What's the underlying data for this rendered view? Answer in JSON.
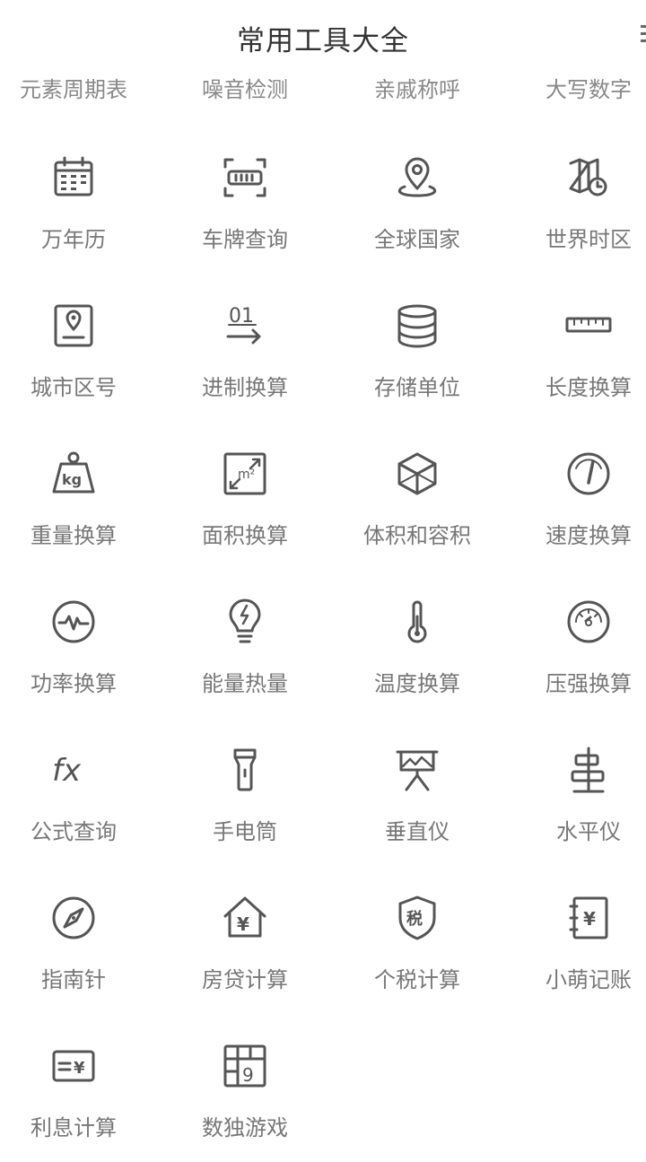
{
  "header": {
    "title": "常用工具大全"
  },
  "top_items": [
    "元素周期表",
    "噪音检测",
    "亲戚称呼",
    "大写数字"
  ],
  "tools": [
    {
      "label": "万年历",
      "icon": "calendar-icon"
    },
    {
      "label": "车牌查询",
      "icon": "license-plate-scan-icon"
    },
    {
      "label": "全球国家",
      "icon": "map-pin-icon"
    },
    {
      "label": "世界时区",
      "icon": "map-clock-icon"
    },
    {
      "label": "城市区号",
      "icon": "location-card-icon"
    },
    {
      "label": "进制换算",
      "icon": "binary-convert-icon"
    },
    {
      "label": "存储单位",
      "icon": "database-icon"
    },
    {
      "label": "长度换算",
      "icon": "ruler-icon"
    },
    {
      "label": "重量换算",
      "icon": "weight-kg-icon"
    },
    {
      "label": "面积换算",
      "icon": "area-m2-icon"
    },
    {
      "label": "体积和容积",
      "icon": "cube-icon"
    },
    {
      "label": "速度换算",
      "icon": "speedometer-icon"
    },
    {
      "label": "功率换算",
      "icon": "pulse-icon"
    },
    {
      "label": "能量热量",
      "icon": "energy-bulb-icon"
    },
    {
      "label": "温度换算",
      "icon": "thermometer-icon"
    },
    {
      "label": "压强换算",
      "icon": "pressure-gauge-icon"
    },
    {
      "label": "公式查询",
      "icon": "fx-formula-icon"
    },
    {
      "label": "手电筒",
      "icon": "flashlight-icon"
    },
    {
      "label": "垂直仪",
      "icon": "vertical-level-icon"
    },
    {
      "label": "水平仪",
      "icon": "horizontal-level-icon"
    },
    {
      "label": "指南针",
      "icon": "compass-icon"
    },
    {
      "label": "房贷计算",
      "icon": "house-yen-icon"
    },
    {
      "label": "个税计算",
      "icon": "tax-shield-icon"
    },
    {
      "label": "小萌记账",
      "icon": "ledger-yen-icon"
    },
    {
      "label": "利息计算",
      "icon": "interest-card-icon"
    },
    {
      "label": "数独游戏",
      "icon": "sudoku-grid-icon"
    }
  ],
  "icon_text": {
    "binary": "01",
    "kg": "kg",
    "m2": "m²",
    "fx": "fx",
    "tax": "税",
    "yen": "¥",
    "sudoku": "9"
  }
}
